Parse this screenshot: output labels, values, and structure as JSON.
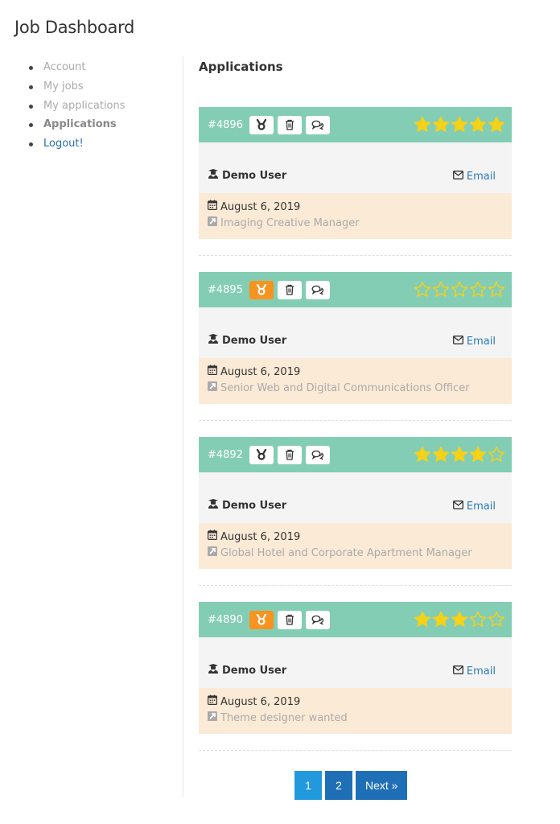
{
  "page": {
    "title": "Job Dashboard"
  },
  "sidebar": {
    "items": [
      {
        "label": "Account",
        "state": "normal"
      },
      {
        "label": "My jobs",
        "state": "normal"
      },
      {
        "label": "My applications",
        "state": "normal"
      },
      {
        "label": "Applications",
        "state": "active"
      },
      {
        "label": "Logout!",
        "state": "logout"
      }
    ]
  },
  "main": {
    "title": "Applications",
    "applications": [
      {
        "id": "#4896",
        "shortlisted": false,
        "rating": 5,
        "max_rating": 5,
        "user": "Demo User",
        "email_label": "Email",
        "date": "August 6, 2019",
        "job": "Imaging Creative Manager"
      },
      {
        "id": "#4895",
        "shortlisted": true,
        "rating": 0,
        "max_rating": 5,
        "user": "Demo User",
        "email_label": "Email",
        "date": "August 6, 2019",
        "job": "Senior Web and Digital Communications Officer"
      },
      {
        "id": "#4892",
        "shortlisted": false,
        "rating": 4,
        "max_rating": 5,
        "user": "Demo User",
        "email_label": "Email",
        "date": "August 6, 2019",
        "job": "Global Hotel and Corporate Apartment Manager"
      },
      {
        "id": "#4890",
        "shortlisted": true,
        "rating": 3,
        "max_rating": 5,
        "user": "Demo User",
        "email_label": "Email",
        "date": "August 6, 2019",
        "job": "Theme designer wanted"
      }
    ],
    "icons": {
      "shortlist": "medal-icon",
      "delete": "trash-icon",
      "message": "chat-icon",
      "user": "user-graduate-icon",
      "email": "envelope-icon",
      "date": "calendar-icon",
      "job": "external-link-icon",
      "star_filled": "star-filled-icon",
      "star_empty": "star-outline-icon"
    }
  },
  "pagination": {
    "current": 1,
    "pages": [
      "1",
      "2"
    ],
    "next_label": "Next »"
  },
  "colors": {
    "card_header": "#84cdb5",
    "shortlist_active": "#f7931e",
    "star": "#f5d117",
    "info_bg": "#fbead6",
    "user_bg": "#f4f4f4",
    "link": "#2a7ab8",
    "pagination": "#1f6fb7",
    "pagination_current": "#2299dd"
  }
}
